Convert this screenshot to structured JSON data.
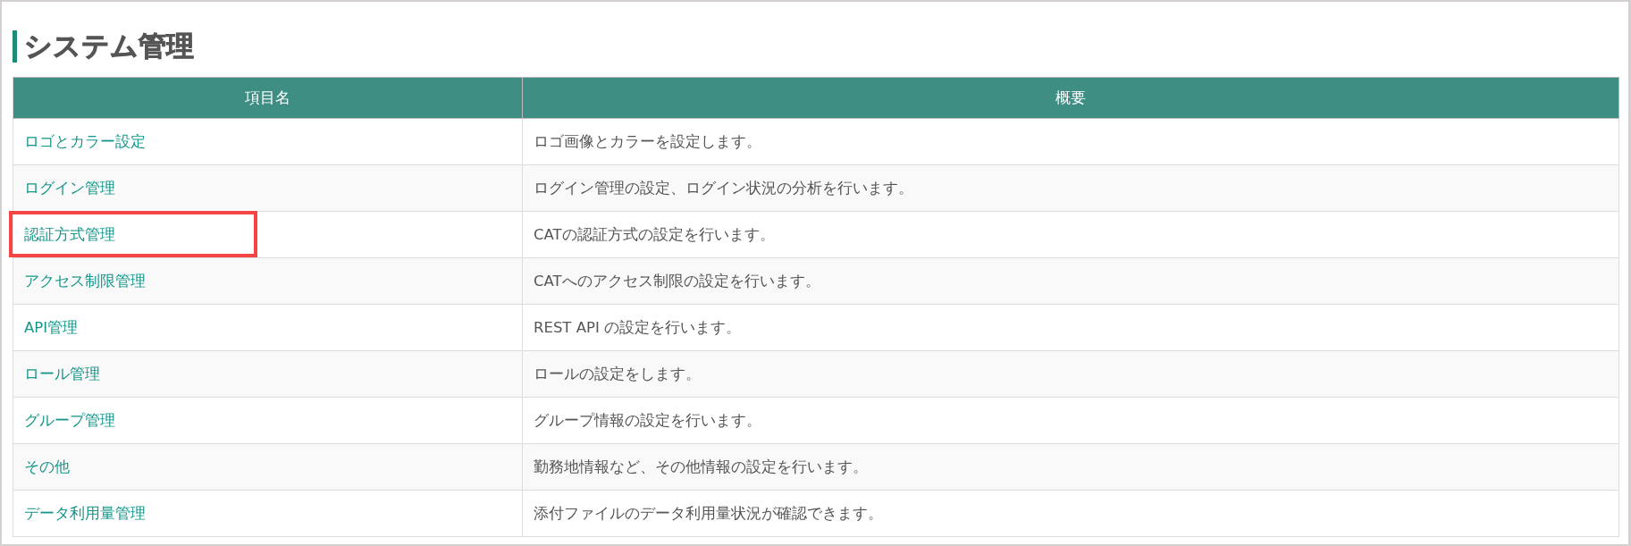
{
  "title": "システム管理",
  "table": {
    "columns": [
      "項目名",
      "概要"
    ],
    "rows": [
      {
        "name": "ロゴとカラー設定",
        "summary": "ロゴ画像とカラーを設定します。",
        "highlighted": false
      },
      {
        "name": "ログイン管理",
        "summary": "ログイン管理の設定、ログイン状況の分析を行います。",
        "highlighted": false
      },
      {
        "name": "認証方式管理",
        "summary": "CATの認証方式の設定を行います。",
        "highlighted": true
      },
      {
        "name": "アクセス制限管理",
        "summary": "CATへのアクセス制限の設定を行います。",
        "highlighted": false
      },
      {
        "name": "API管理",
        "summary": "REST API の設定を行います。",
        "highlighted": false
      },
      {
        "name": "ロール管理",
        "summary": "ロールの設定をします。",
        "highlighted": false
      },
      {
        "name": "グループ管理",
        "summary": "グループ情報の設定を行います。",
        "highlighted": false
      },
      {
        "name": "その他",
        "summary": "勤務地情報など、その他情報の設定を行います。",
        "highlighted": false
      },
      {
        "name": "データ利用量管理",
        "summary": "添付ファイルのデータ利用量状況が確認できます。",
        "highlighted": false
      }
    ]
  }
}
